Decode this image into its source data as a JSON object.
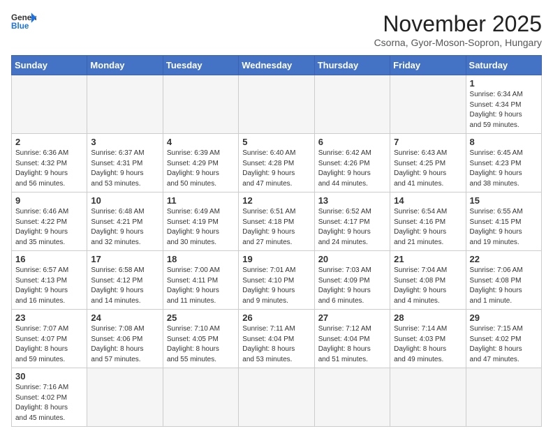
{
  "header": {
    "logo_general": "General",
    "logo_blue": "Blue",
    "month_title": "November 2025",
    "subtitle": "Csorna, Gyor-Moson-Sopron, Hungary"
  },
  "weekdays": [
    "Sunday",
    "Monday",
    "Tuesday",
    "Wednesday",
    "Thursday",
    "Friday",
    "Saturday"
  ],
  "weeks": [
    [
      {
        "day": "",
        "info": "",
        "empty": true
      },
      {
        "day": "",
        "info": "",
        "empty": true
      },
      {
        "day": "",
        "info": "",
        "empty": true
      },
      {
        "day": "",
        "info": "",
        "empty": true
      },
      {
        "day": "",
        "info": "",
        "empty": true
      },
      {
        "day": "",
        "info": "",
        "empty": true
      },
      {
        "day": "1",
        "info": "Sunrise: 6:34 AM\nSunset: 4:34 PM\nDaylight: 9 hours\nand 59 minutes.",
        "empty": false
      }
    ],
    [
      {
        "day": "2",
        "info": "Sunrise: 6:36 AM\nSunset: 4:32 PM\nDaylight: 9 hours\nand 56 minutes.",
        "empty": false
      },
      {
        "day": "3",
        "info": "Sunrise: 6:37 AM\nSunset: 4:31 PM\nDaylight: 9 hours\nand 53 minutes.",
        "empty": false
      },
      {
        "day": "4",
        "info": "Sunrise: 6:39 AM\nSunset: 4:29 PM\nDaylight: 9 hours\nand 50 minutes.",
        "empty": false
      },
      {
        "day": "5",
        "info": "Sunrise: 6:40 AM\nSunset: 4:28 PM\nDaylight: 9 hours\nand 47 minutes.",
        "empty": false
      },
      {
        "day": "6",
        "info": "Sunrise: 6:42 AM\nSunset: 4:26 PM\nDaylight: 9 hours\nand 44 minutes.",
        "empty": false
      },
      {
        "day": "7",
        "info": "Sunrise: 6:43 AM\nSunset: 4:25 PM\nDaylight: 9 hours\nand 41 minutes.",
        "empty": false
      },
      {
        "day": "8",
        "info": "Sunrise: 6:45 AM\nSunset: 4:23 PM\nDaylight: 9 hours\nand 38 minutes.",
        "empty": false
      }
    ],
    [
      {
        "day": "9",
        "info": "Sunrise: 6:46 AM\nSunset: 4:22 PM\nDaylight: 9 hours\nand 35 minutes.",
        "empty": false
      },
      {
        "day": "10",
        "info": "Sunrise: 6:48 AM\nSunset: 4:21 PM\nDaylight: 9 hours\nand 32 minutes.",
        "empty": false
      },
      {
        "day": "11",
        "info": "Sunrise: 6:49 AM\nSunset: 4:19 PM\nDaylight: 9 hours\nand 30 minutes.",
        "empty": false
      },
      {
        "day": "12",
        "info": "Sunrise: 6:51 AM\nSunset: 4:18 PM\nDaylight: 9 hours\nand 27 minutes.",
        "empty": false
      },
      {
        "day": "13",
        "info": "Sunrise: 6:52 AM\nSunset: 4:17 PM\nDaylight: 9 hours\nand 24 minutes.",
        "empty": false
      },
      {
        "day": "14",
        "info": "Sunrise: 6:54 AM\nSunset: 4:16 PM\nDaylight: 9 hours\nand 21 minutes.",
        "empty": false
      },
      {
        "day": "15",
        "info": "Sunrise: 6:55 AM\nSunset: 4:15 PM\nDaylight: 9 hours\nand 19 minutes.",
        "empty": false
      }
    ],
    [
      {
        "day": "16",
        "info": "Sunrise: 6:57 AM\nSunset: 4:13 PM\nDaylight: 9 hours\nand 16 minutes.",
        "empty": false
      },
      {
        "day": "17",
        "info": "Sunrise: 6:58 AM\nSunset: 4:12 PM\nDaylight: 9 hours\nand 14 minutes.",
        "empty": false
      },
      {
        "day": "18",
        "info": "Sunrise: 7:00 AM\nSunset: 4:11 PM\nDaylight: 9 hours\nand 11 minutes.",
        "empty": false
      },
      {
        "day": "19",
        "info": "Sunrise: 7:01 AM\nSunset: 4:10 PM\nDaylight: 9 hours\nand 9 minutes.",
        "empty": false
      },
      {
        "day": "20",
        "info": "Sunrise: 7:03 AM\nSunset: 4:09 PM\nDaylight: 9 hours\nand 6 minutes.",
        "empty": false
      },
      {
        "day": "21",
        "info": "Sunrise: 7:04 AM\nSunset: 4:08 PM\nDaylight: 9 hours\nand 4 minutes.",
        "empty": false
      },
      {
        "day": "22",
        "info": "Sunrise: 7:06 AM\nSunset: 4:08 PM\nDaylight: 9 hours\nand 1 minute.",
        "empty": false
      }
    ],
    [
      {
        "day": "23",
        "info": "Sunrise: 7:07 AM\nSunset: 4:07 PM\nDaylight: 8 hours\nand 59 minutes.",
        "empty": false
      },
      {
        "day": "24",
        "info": "Sunrise: 7:08 AM\nSunset: 4:06 PM\nDaylight: 8 hours\nand 57 minutes.",
        "empty": false
      },
      {
        "day": "25",
        "info": "Sunrise: 7:10 AM\nSunset: 4:05 PM\nDaylight: 8 hours\nand 55 minutes.",
        "empty": false
      },
      {
        "day": "26",
        "info": "Sunrise: 7:11 AM\nSunset: 4:04 PM\nDaylight: 8 hours\nand 53 minutes.",
        "empty": false
      },
      {
        "day": "27",
        "info": "Sunrise: 7:12 AM\nSunset: 4:04 PM\nDaylight: 8 hours\nand 51 minutes.",
        "empty": false
      },
      {
        "day": "28",
        "info": "Sunrise: 7:14 AM\nSunset: 4:03 PM\nDaylight: 8 hours\nand 49 minutes.",
        "empty": false
      },
      {
        "day": "29",
        "info": "Sunrise: 7:15 AM\nSunset: 4:02 PM\nDaylight: 8 hours\nand 47 minutes.",
        "empty": false
      }
    ],
    [
      {
        "day": "30",
        "info": "Sunrise: 7:16 AM\nSunset: 4:02 PM\nDaylight: 8 hours\nand 45 minutes.",
        "empty": false
      },
      {
        "day": "",
        "info": "",
        "empty": true
      },
      {
        "day": "",
        "info": "",
        "empty": true
      },
      {
        "day": "",
        "info": "",
        "empty": true
      },
      {
        "day": "",
        "info": "",
        "empty": true
      },
      {
        "day": "",
        "info": "",
        "empty": true
      },
      {
        "day": "",
        "info": "",
        "empty": true
      }
    ]
  ]
}
